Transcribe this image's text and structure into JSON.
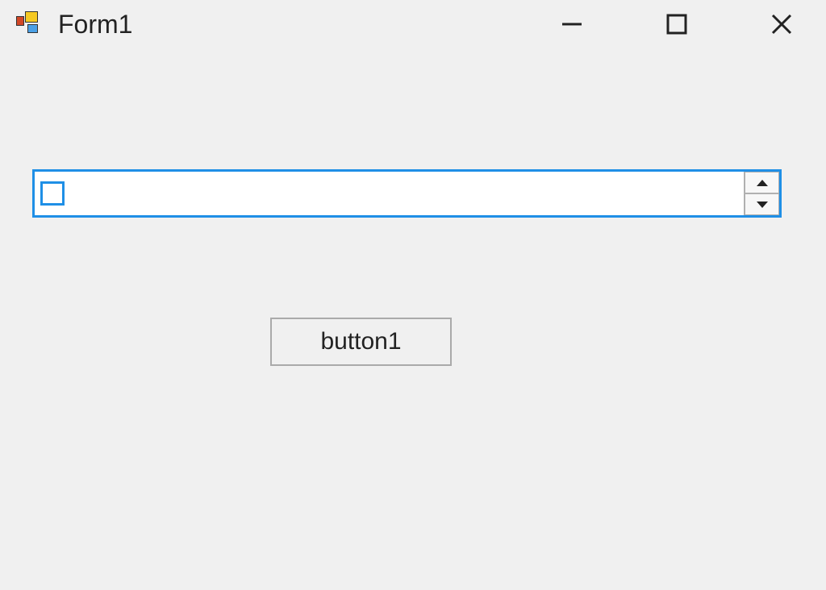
{
  "window": {
    "title": "Form1"
  },
  "numericUpDown": {
    "value": ""
  },
  "button": {
    "label": "button1"
  }
}
